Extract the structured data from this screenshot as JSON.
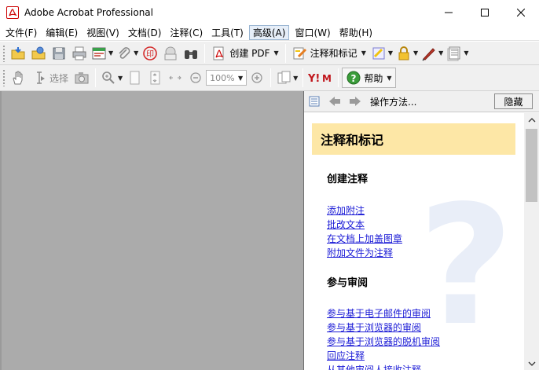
{
  "window": {
    "title": "Adobe Acrobat Professional"
  },
  "menu": [
    {
      "label": "文件(F)"
    },
    {
      "label": "编辑(E)"
    },
    {
      "label": "视图(V)"
    },
    {
      "label": "文档(D)"
    },
    {
      "label": "注释(C)"
    },
    {
      "label": "工具(T)"
    },
    {
      "label": "高级(A)"
    },
    {
      "label": "窗口(W)"
    },
    {
      "label": "帮助(H)"
    }
  ],
  "toolbar1": {
    "create_pdf_label": "创建 PDF",
    "comment_markup_label": "注释和标记"
  },
  "toolbar2": {
    "select_label": "选择",
    "zoom_value": "100%",
    "help_label": "帮助"
  },
  "panel": {
    "how_to_label": "操作方法...",
    "hide_label": "隐藏",
    "banner": "注释和标记",
    "section1": "创建注释",
    "links1": [
      "添加附注",
      "批改文本",
      "在文档上加盖图章",
      "附加文件为注释"
    ],
    "section2": "参与审阅",
    "links2": [
      "参与基于电子邮件的审阅",
      "参与基于浏览器的审阅",
      "参与基于浏览器的脱机审阅",
      "回应注释",
      "从其他审阅人接收注释"
    ]
  },
  "colors": {
    "doc_background": "#ababab",
    "banner": "#fde7a6",
    "link": "#1a1ad6",
    "acrobat_red": "#cc0000"
  }
}
